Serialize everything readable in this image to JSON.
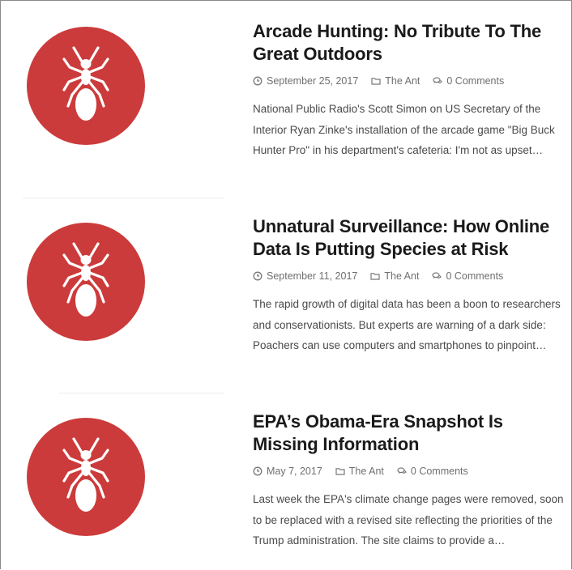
{
  "posts": [
    {
      "title": "Arcade Hunting: No Tribute To The Great Outdoors",
      "date": "September 25, 2017",
      "category": "The Ant",
      "comments": "0 Comments",
      "excerpt": "National Public Radio's Scott Simon on US Secretary of the Interior Ryan Zinke's installation of the arcade game \"Big Buck Hunter Pro\" in his department's cafeteria: I'm not as upset…"
    },
    {
      "title": "Unnatural Surveillance: How Online Data Is Putting Species at Risk",
      "date": "September 11, 2017",
      "category": "The Ant",
      "comments": "0 Comments",
      "excerpt": "The rapid growth of digital data has been a boon to researchers and conservationists. But experts are warning of a dark side: Poachers can use computers and smartphones to pinpoint…"
    },
    {
      "title": "EPA’s Obama-Era Snapshot Is Missing Information",
      "date": "May 7, 2017",
      "category": "The Ant",
      "comments": "0 Comments",
      "excerpt": "Last week the EPA's climate change pages were removed, soon to be replaced with a revised site reflecting the priorities of the Trump administration. The site claims to provide a…"
    }
  ],
  "icons": {
    "thumbnail": "ant-icon",
    "date": "clock-icon",
    "category": "folder-icon",
    "comments": "comments-icon"
  },
  "colors": {
    "thumbnail_bg": "#cc3b3b",
    "title": "#1a1a1a",
    "meta": "#6f6f6f",
    "excerpt": "#4a4a4a"
  }
}
